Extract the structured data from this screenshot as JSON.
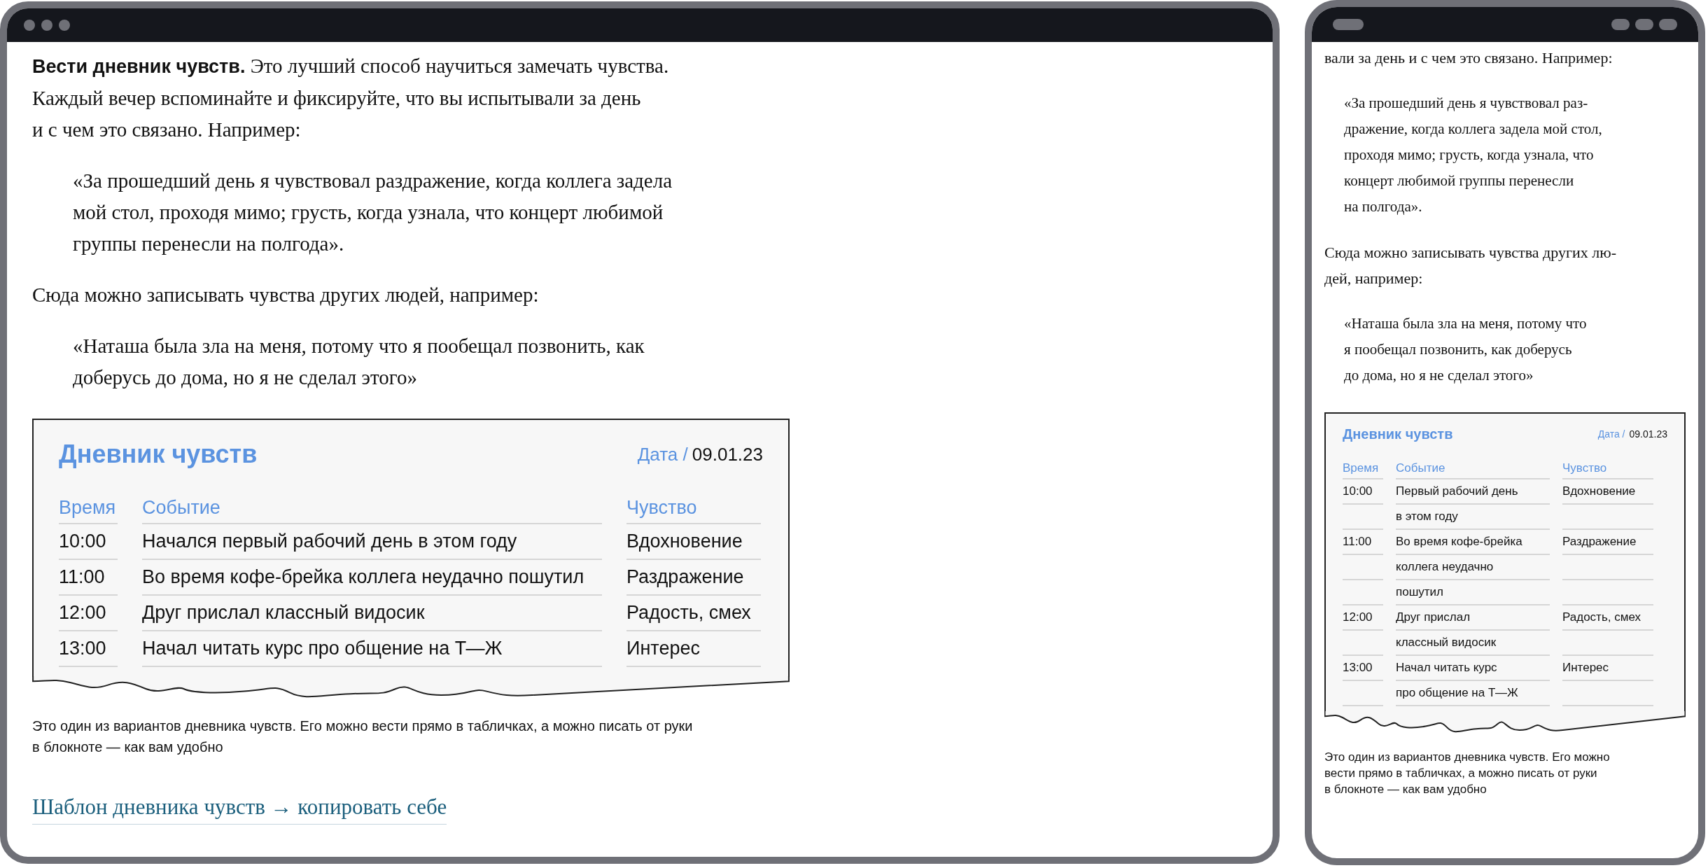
{
  "desktop": {
    "intro": {
      "lines": [
        "**Вести дневник чувств.** Это лучший способ научиться замечать чувства.",
        "Каждый вечер вспоминайте и фиксируйте, что вы испытывали за день",
        "и с чем это связано. Например:"
      ]
    },
    "quote_1": {
      "lines": [
        "«За прошедший день я чувствовал раздражение, когда коллега задела",
        "мой стол, проходя мимо; грусть, когда узнала, что концерт любимой",
        "группы перенесли на полгода»."
      ]
    },
    "paragraph": {
      "lines": [
        "Сюда можно записывать чувства других людей, например:"
      ]
    },
    "quote_2": {
      "lines": [
        "«Наташа была зла на меня, потому что я пообещал позвонить, как",
        "доберусь до дома, но я не сделал этого»"
      ]
    },
    "diary": {
      "title": "Дневник чувств",
      "date_label": "Дата /",
      "date": "09.01.23",
      "columns": [
        "Время",
        "Событие",
        "Чувство"
      ],
      "rows": [
        {
          "time": "10:00",
          "event": [
            "Начался первый рабочий день в этом году"
          ],
          "feeling": "Вдохновение"
        },
        {
          "time": "11:00",
          "event": [
            "Во время кофе-брейка коллега неудачно пошутил"
          ],
          "feeling": "Раздражение"
        },
        {
          "time": "12:00",
          "event": [
            "Друг прислал классный видосик"
          ],
          "feeling": "Радость, смех"
        },
        {
          "time": "13:00",
          "event": [
            "Начал читать курс про общение на Т—Ж"
          ],
          "feeling": "Интерес"
        }
      ]
    },
    "caption": {
      "lines": [
        "Это один из вариантов дневника чувств. Его можно вести прямо в табличках, а можно писать от руки",
        "в блокноте — как вам удобно"
      ]
    },
    "link": "Шаблон дневника чувств → копировать себе"
  },
  "mobile": {
    "intro": {
      "lines": [
        "вали за день и с чем это связано. Например:"
      ]
    },
    "quote_1": {
      "lines": [
        "«За прошедший день я чувствовал раз-",
        "дражение, когда коллега задела мой стол,",
        "проходя мимо; грусть, когда узнала, что",
        "концерт любимой группы перенесли",
        "на полгода»."
      ]
    },
    "paragraph": {
      "lines": [
        "Сюда можно записывать чувства других лю-",
        "дей, например:"
      ]
    },
    "quote_2": {
      "lines": [
        "«Наташа была зла на меня, потому что",
        "я пообещал позвонить, как доберусь",
        "до дома, но я не сделал этого»"
      ]
    },
    "diary": {
      "title": "Дневник чувств",
      "date_label": "Дата /",
      "date": "09.01.23",
      "columns": [
        "Время",
        "Событие",
        "Чувство"
      ],
      "rows": [
        {
          "time": "10:00",
          "event": [
            "Первый рабочий день",
            "в этом году"
          ],
          "feeling": "Вдохновение"
        },
        {
          "time": "11:00",
          "event": [
            "Во время кофе-брейка",
            "коллега неудачно",
            "пошутил"
          ],
          "feeling": "Раздражение"
        },
        {
          "time": "12:00",
          "event": [
            "Друг прислал",
            "классный видосик"
          ],
          "feeling": "Радость, смех"
        },
        {
          "time": "13:00",
          "event": [
            "Начал читать курс",
            "про общение на Т—Ж"
          ],
          "feeling": "Интерес"
        }
      ]
    },
    "caption": {
      "lines": [
        "Это один из вариантов дневника чувств. Его можно",
        "вести прямо в табличках, а можно писать от руки",
        "в блокноте — как вам удобно"
      ]
    }
  }
}
